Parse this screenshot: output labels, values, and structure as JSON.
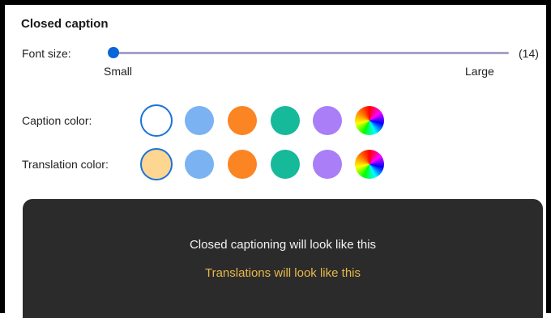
{
  "section": {
    "title": "Closed caption"
  },
  "font_size": {
    "label": "Font size:",
    "value": 14,
    "value_text": "(14)",
    "min_label": "Small",
    "max_label": "Large",
    "level_fraction": 0.0
  },
  "caption_color": {
    "label": "Caption color:",
    "options": [
      {
        "name": "white",
        "color": "#ffffff",
        "selected": true
      },
      {
        "name": "blue",
        "color": "#7ab2f2",
        "selected": false
      },
      {
        "name": "orange",
        "color": "#fb8423",
        "selected": false
      },
      {
        "name": "teal",
        "color": "#16b99a",
        "selected": false
      },
      {
        "name": "purple",
        "color": "#a97ef7",
        "selected": false
      },
      {
        "name": "custom",
        "color": "rainbow",
        "selected": false
      }
    ]
  },
  "translation_color": {
    "label": "Translation color:",
    "options": [
      {
        "name": "yellow",
        "color": "#fdd692",
        "selected": true
      },
      {
        "name": "blue",
        "color": "#7ab2f2",
        "selected": false
      },
      {
        "name": "orange",
        "color": "#fb8423",
        "selected": false
      },
      {
        "name": "teal",
        "color": "#16b99a",
        "selected": false
      },
      {
        "name": "purple",
        "color": "#a97ef7",
        "selected": false
      },
      {
        "name": "custom",
        "color": "rainbow",
        "selected": false
      }
    ]
  },
  "preview": {
    "caption_text": "Closed captioning will look like this",
    "translation_text": "Translations will look like this",
    "background": "#2b2b2b",
    "caption_color": "#f2f2f2",
    "translation_color": "#e8b84a"
  }
}
